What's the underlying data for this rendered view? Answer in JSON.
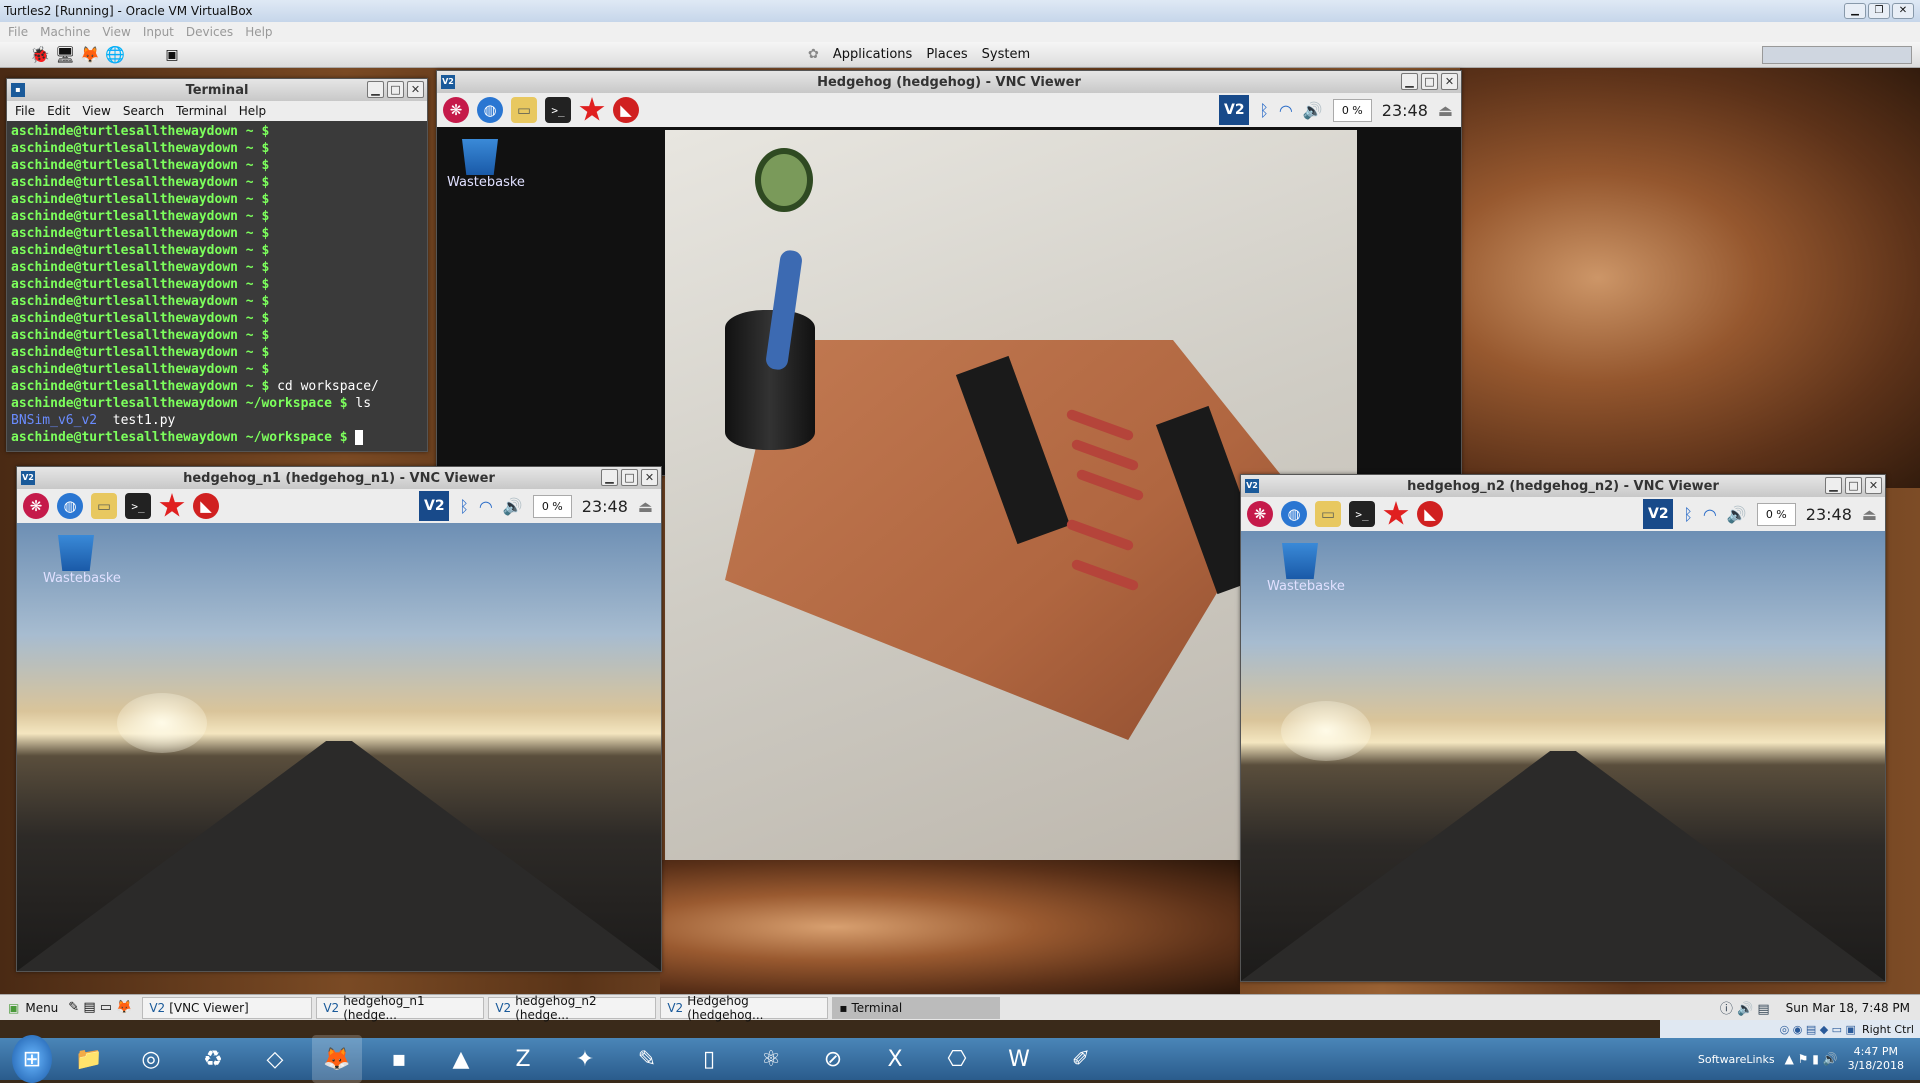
{
  "vbox": {
    "title": "Turtles2 [Running] - Oracle VM VirtualBox",
    "menu": [
      "File",
      "Machine",
      "View",
      "Input",
      "Devices",
      "Help"
    ]
  },
  "gnome": {
    "menus": [
      "Applications",
      "Places",
      "System"
    ]
  },
  "terminal": {
    "title": "Terminal",
    "menu": [
      "File",
      "Edit",
      "View",
      "Search",
      "Terminal",
      "Help"
    ],
    "prompt": "aschinde@turtlesalltheway​down ~ $",
    "prompt_repeat": 15,
    "cmd1": "cd workspace/",
    "prompt_ws": "aschinde@turtlesalltheway​down ~/workspace $",
    "cmd2": "ls",
    "ls_dir": "BNSim_v6_v2",
    "ls_file": "test1.py"
  },
  "vnc_main": {
    "title": "Hedgehog (hedgehog) - VNC Viewer",
    "cpu": "0 %",
    "clock": "23:48",
    "trash": "Wastebaske"
  },
  "vnc_n1": {
    "title": "hedgehog_n1 (hedgehog_n1) - VNC Viewer",
    "cpu": "0 %",
    "clock": "23:48",
    "trash": "Wastebaske"
  },
  "vnc_n2": {
    "title": "hedgehog_n2 (hedgehog_n2) - VNC Viewer",
    "cpu": "0 %",
    "clock": "23:48",
    "trash": "Wastebaske"
  },
  "linux_taskbar": {
    "menu": "Menu",
    "items": [
      "[VNC Viewer]",
      "hedgehog_n1 (hedge...",
      "hedgehog_n2 (hedge...",
      "Hedgehog (hedgehog...",
      "Terminal"
    ],
    "clock": "Sun Mar 18, 7:48 PM",
    "host_key": "Right Ctrl"
  },
  "win_taskbar": {
    "toolbar": "SoftwareLinks",
    "time": "4:47 PM",
    "date": "3/18/2018"
  },
  "icons": [
    "raspberry-icon",
    "globe-icon",
    "folder-icon",
    "terminal-icon",
    "mathematica-icon",
    "wolfram-icon"
  ]
}
